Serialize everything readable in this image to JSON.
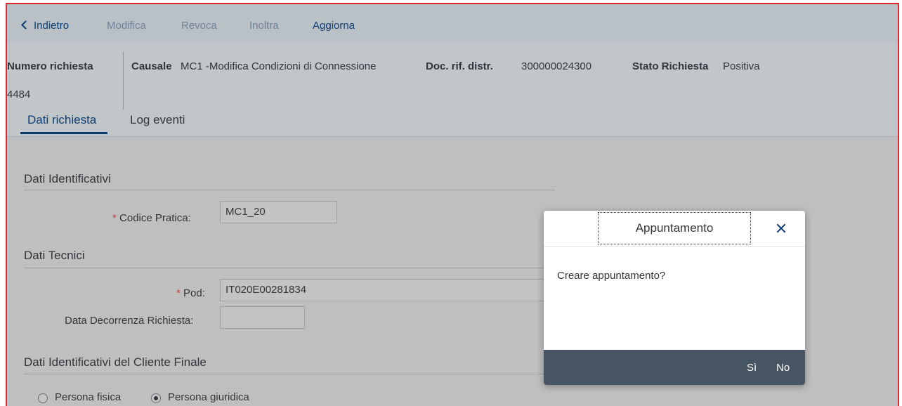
{
  "toolbar": {
    "back_label": "Indietro",
    "edit_label": "Modifica",
    "revoke_label": "Revoca",
    "forward_label": "Inoltra",
    "refresh_label": "Aggiorna"
  },
  "header": {
    "request_number_label": "Numero richiesta",
    "request_number_value": "4484",
    "reason_label": "Causale",
    "reason_value": "MC1 -Modifica Condizioni di Connessione",
    "doc_ref_label": "Doc. rif. distr.",
    "doc_ref_value": "300000024300",
    "status_label": "Stato Richiesta",
    "status_value": "Positiva"
  },
  "tabs": [
    {
      "label": "Dati richiesta",
      "active": true
    },
    {
      "label": "Log eventi",
      "active": false
    }
  ],
  "sections": {
    "identification": {
      "title": "Dati Identificativi",
      "practice_code_label": "Codice Pratica:",
      "practice_code_value": "MC1_20"
    },
    "technical": {
      "title": "Dati Tecnici",
      "pod_label": "Pod:",
      "pod_value": "IT020E00281834",
      "start_date_label": "Data Decorrenza Richiesta:",
      "start_date_value": ""
    },
    "customer": {
      "title": "Dati Identificativi del Cliente Finale",
      "options": [
        {
          "label": "Persona fisica",
          "selected": false
        },
        {
          "label": "Persona giuridica",
          "selected": true
        }
      ]
    }
  },
  "required_marker": "*",
  "dialog": {
    "title": "Appuntamento",
    "message": "Creare appuntamento?",
    "yes_label": "Sì",
    "no_label": "No"
  }
}
